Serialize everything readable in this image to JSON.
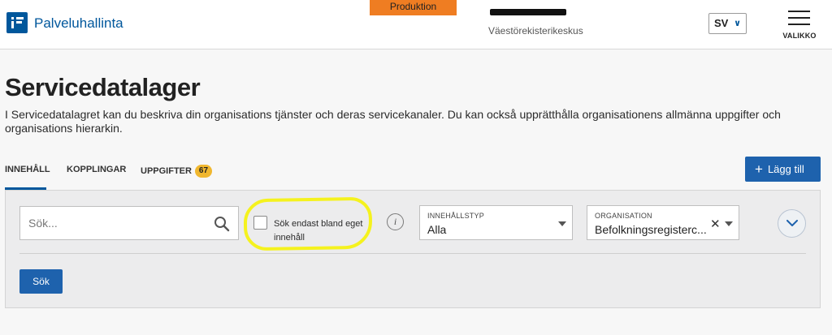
{
  "header": {
    "app_title": "Palveluhallinta",
    "environment_badge": "Produktion",
    "organization": "Väestörekisterikeskus",
    "language": "SV",
    "menu_label": "VALIKKO"
  },
  "page": {
    "title": "Servicedatalager",
    "description": "I Servicedatalagret kan du beskriva din organisations tjänster och deras servicekanaler. Du kan också upprätthålla organisationens allmänna uppgifter och organisations hierarkin."
  },
  "tabs": [
    {
      "label": "INNEHÅLL",
      "active": true
    },
    {
      "label": "KOPPLINGAR",
      "active": false
    },
    {
      "label": "UPPGIFTER",
      "active": false,
      "badge": "67"
    }
  ],
  "actions": {
    "add_label": "Lägg till"
  },
  "search": {
    "placeholder": "Sök...",
    "own_content_checkbox_label": "Sök endast bland eget innehåll",
    "own_content_checked": false,
    "content_type": {
      "label": "INNEHÅLLSTYP",
      "value": "Alla"
    },
    "organization": {
      "label": "ORGANISATION",
      "value": "Befolkningsregisterc..."
    },
    "search_button_label": "Sök"
  },
  "colors": {
    "brand": "#00579c",
    "primary_button": "#1e62ad",
    "environment_badge": "#ef7d22",
    "tab_badge": "#f0b72f",
    "highlight_annotation": "#f5f21e"
  },
  "icons": [
    "logo-icon",
    "search-icon",
    "info-icon",
    "chevron-down-icon",
    "hamburger-menu-icon",
    "plus-icon",
    "clear-icon",
    "caret-down-icon"
  ]
}
